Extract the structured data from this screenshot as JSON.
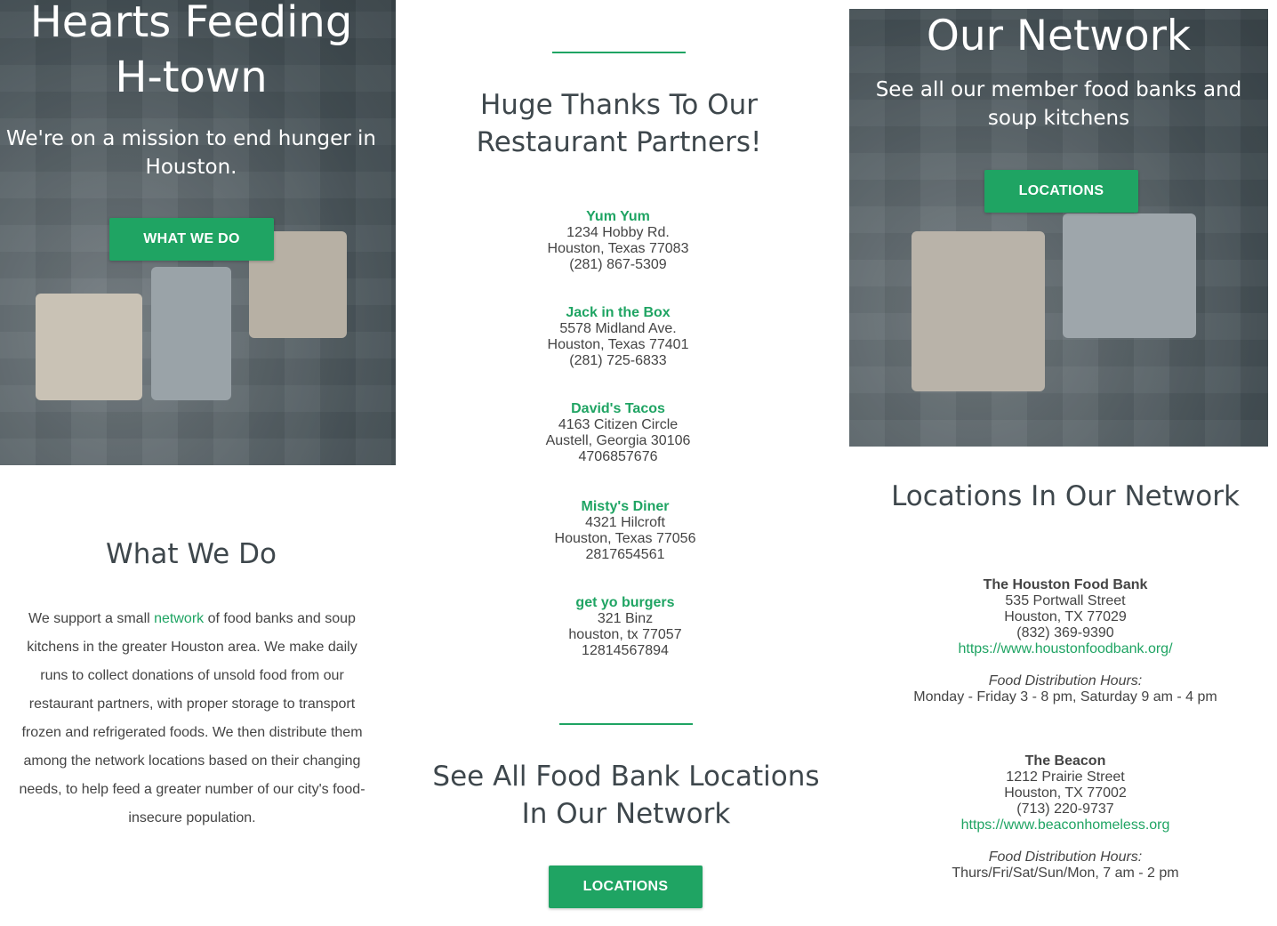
{
  "colors": {
    "accent": "#1fa463",
    "heading": "#3e474c",
    "text": "#444444"
  },
  "hero_left": {
    "title": "Hearts Feeding H-town",
    "subtitle": "We're on a mission to end hunger in Houston.",
    "button": "WHAT WE DO"
  },
  "what_we_do": {
    "title": "What We Do",
    "text_before": "We support a small ",
    "link": "network",
    "text_after": " of food banks and soup kitchens in the greater Houston area. We make daily runs to collect donations of unsold food from our restaurant partners, with proper storage to transport frozen and refrigerated foods. We then distribute them among the network locations based on their changing needs, to help feed a greater number of our city's food-insecure population."
  },
  "partners": {
    "title": "Huge Thanks To Our Restaurant Partners!",
    "items": [
      {
        "name": "Yum Yum",
        "line1": "1234 Hobby Rd.",
        "line2": "Houston, Texas 77083",
        "phone": "(281) 867-5309"
      },
      {
        "name": "Jack in the Box",
        "line1": "5578 Midland Ave.",
        "line2": "Houston, Texas 77401",
        "phone": "(281) 725-6833"
      },
      {
        "name": "David's Tacos",
        "line1": "4163 Citizen Circle",
        "line2": "Austell, Georgia 30106",
        "phone": "4706857676"
      },
      {
        "name": "Misty's Diner",
        "line1": "4321 Hilcroft",
        "line2": "Houston, Texas 77056",
        "phone": "2817654561"
      },
      {
        "name": "get yo burgers",
        "line1": "321 Binz",
        "line2": "houston, tx 77057",
        "phone": "12814567894"
      }
    ]
  },
  "see_all": {
    "title": "See All Food Bank Locations In Our Network",
    "button": "LOCATIONS"
  },
  "hero_right": {
    "title": "Our Network",
    "subtitle": "See all our member food banks and soup kitchens",
    "button": "LOCATIONS"
  },
  "locations": {
    "title": "Locations In Our Network",
    "items": [
      {
        "name": "The Houston Food Bank",
        "line1": "535 Portwall Street",
        "line2": "Houston, TX 77029",
        "phone": "(832) 369-9390",
        "url": "https://www.houstonfoodbank.org/",
        "hours_label": "Food Distribution Hours:",
        "hours": "Monday - Friday 3 - 8 pm, Saturday 9 am - 4 pm"
      },
      {
        "name": "The Beacon",
        "line1": "1212 Prairie Street",
        "line2": "Houston, TX 77002",
        "phone": "(713) 220-9737",
        "url": "https://www.beaconhomeless.org",
        "hours_label": "Food Distribution Hours:",
        "hours": "Thurs/Fri/Sat/Sun/Mon, 7 am - 2 pm"
      }
    ]
  }
}
